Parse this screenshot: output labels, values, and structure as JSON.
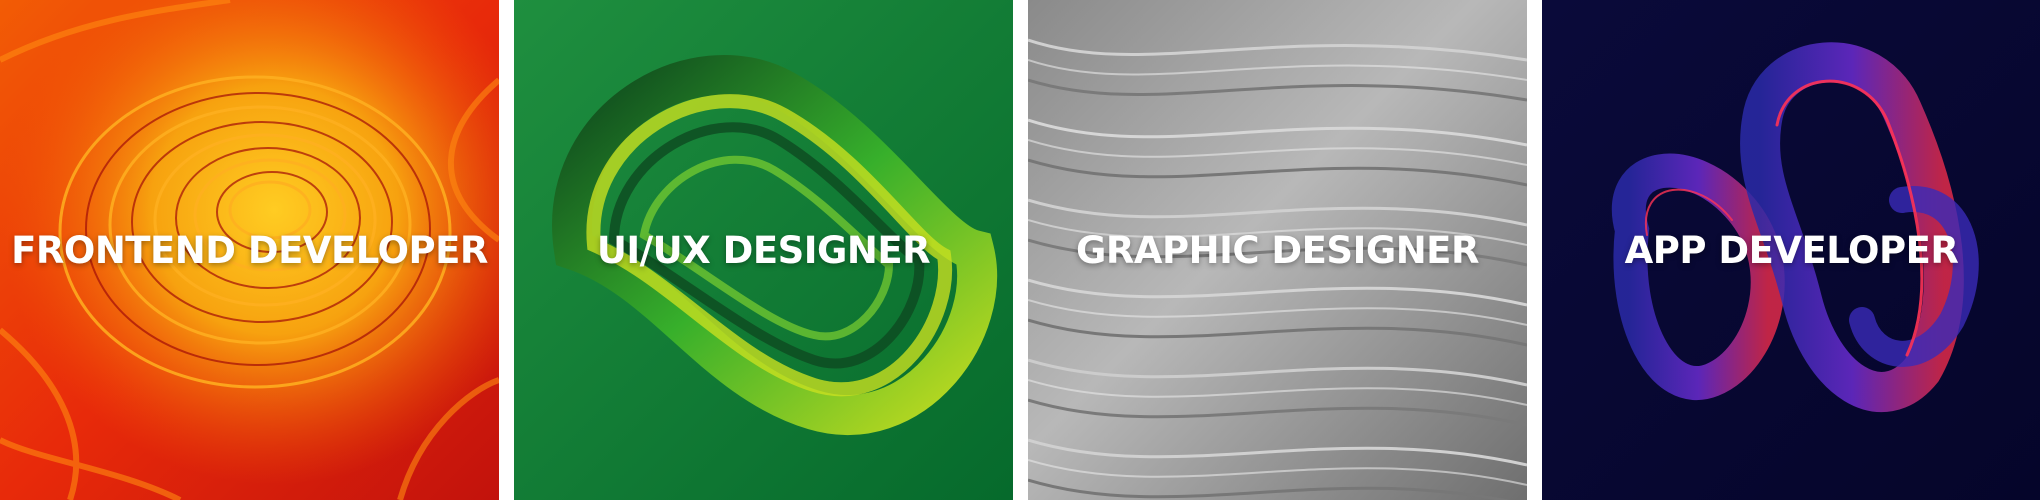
{
  "cards": [
    {
      "title": "FRONTEND DEVELOPER",
      "theme": "orange-red paper swirls",
      "accent": "#e8400c"
    },
    {
      "title": "UI/UX DESIGNER",
      "theme": "green twisted loop",
      "accent": "#0a7d3a"
    },
    {
      "title": "GRAPHIC DESIGNER",
      "theme": "gray paper waves",
      "accent": "#9a9a9a"
    },
    {
      "title": "APP DEVELOPER",
      "theme": "dark blue twisted loop",
      "accent": "#0a0a40"
    }
  ]
}
